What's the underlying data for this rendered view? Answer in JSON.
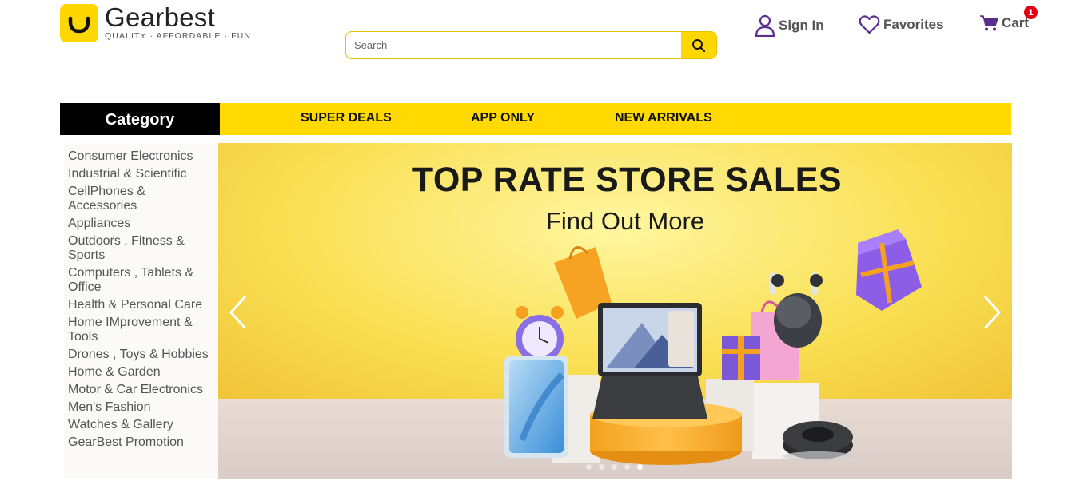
{
  "header": {
    "logo_name": "Gearbest",
    "logo_tagline": "QUALITY · AFFORDABLE · FUN",
    "search_placeholder": "Search",
    "sign_in_label": "Sign In",
    "favorites_label": "Favorites",
    "cart_label": "Cart",
    "cart_count": "1"
  },
  "nav": {
    "category_label": "Category",
    "items": [
      "SUPER DEALS",
      "APP ONLY",
      "NEW ARRIVALS"
    ]
  },
  "sidebar": {
    "categories": [
      "Consumer Electronics",
      "Industrial & Scientific",
      "CellPhones & Accessories",
      "Appliances",
      "Outdoors , Fitness & Sports",
      "Computers , Tablets & Office",
      "Health & Personal Care",
      "Home IMprovement & Tools",
      "Drones , Toys & Hobbies",
      "Home & Garden",
      "Motor & Car Electronics",
      "Men's Fashion",
      "Watches & Gallery",
      "GearBest Promotion"
    ]
  },
  "banner": {
    "title": "TOP RATE STORE SALES",
    "subtitle": "Find Out More",
    "slide_count": 5,
    "active_slide": 5
  },
  "colors": {
    "brand_yellow": "#ffd900",
    "icon_purple": "#5b2d8e",
    "badge_red": "#e0000f",
    "category_black": "#000000"
  },
  "icons": [
    "user-icon",
    "heart-icon",
    "cart-icon",
    "search-icon",
    "chevron-left-icon",
    "chevron-right-icon"
  ]
}
